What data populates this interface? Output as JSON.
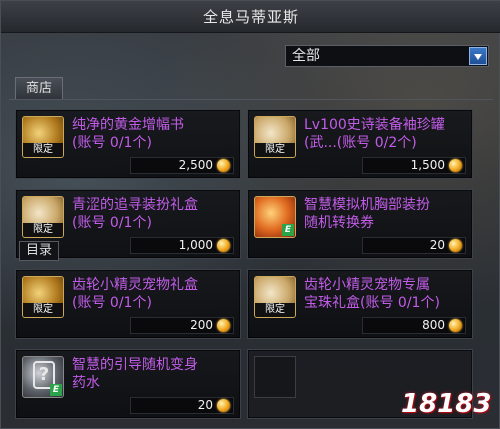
{
  "window": {
    "title": "全息马蒂亚斯"
  },
  "filter": {
    "selected": "全部"
  },
  "tabs": [
    {
      "label": "商店"
    }
  ],
  "catalog_label": "目录",
  "watermark": "18183",
  "items": [
    {
      "name": "纯净的黄金增幅书\n(账号 0/1个)",
      "price": "2,500",
      "icon": "gold-book-icon",
      "badge": "限定"
    },
    {
      "name": "Lv100史诗装备袖珍罐\n(武...(账号 0/2个)",
      "price": "1,500",
      "icon": "epic-jar-icon",
      "badge": "限定"
    },
    {
      "name": "青涩的追寻装扮礼盒\n(账号 0/1个)",
      "price": "1,000",
      "icon": "avatar-box-icon",
      "badge": "限定"
    },
    {
      "name": "智慧模拟机胸部装扮\n随机转换券",
      "price": "20",
      "icon": "ticket-icon",
      "badge": "E"
    },
    {
      "name": "齿轮小精灵宠物礼盒\n(账号 0/1个)",
      "price": "200",
      "icon": "pet-box-icon",
      "badge": "限定"
    },
    {
      "name": "齿轮小精灵宠物专属\n宝珠礼盒(账号 0/1个)",
      "price": "800",
      "icon": "pet-orb-box-icon",
      "badge": "限定"
    },
    {
      "name": "智慧的引导随机变身\n药水",
      "price": "20",
      "icon": "mystery-potion-icon",
      "badge": "E"
    }
  ]
}
